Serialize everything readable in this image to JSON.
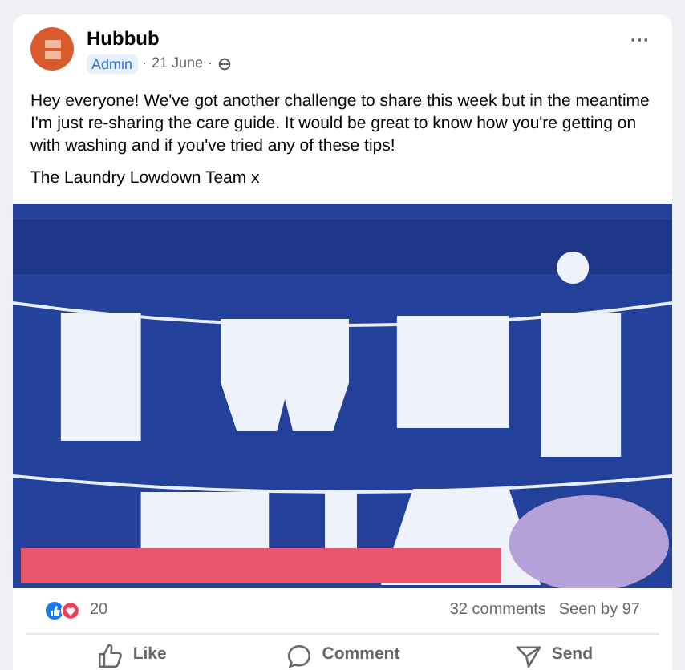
{
  "post": {
    "author": "Hubbub",
    "badge": "Admin",
    "date": "21 June",
    "separator": "·",
    "menu": "···",
    "paragraphs": [
      "Hey everyone! We've got another challenge to share this week but in the meantime I'm just re-sharing the care guide. It would be great to know how you're getting on with washing and if you've tried any of these tips!",
      "The Laundry Lowdown Team x"
    ],
    "image": {
      "kind": "picture"
    },
    "reactions_count": "20",
    "comments": "32 comments",
    "seen_by": "Seen by 97",
    "actions": [
      {
        "kind": "like",
        "label": "Like"
      },
      {
        "kind": "comment",
        "label": "Comment"
      },
      {
        "kind": "send",
        "label": "Send"
      }
    ]
  }
}
